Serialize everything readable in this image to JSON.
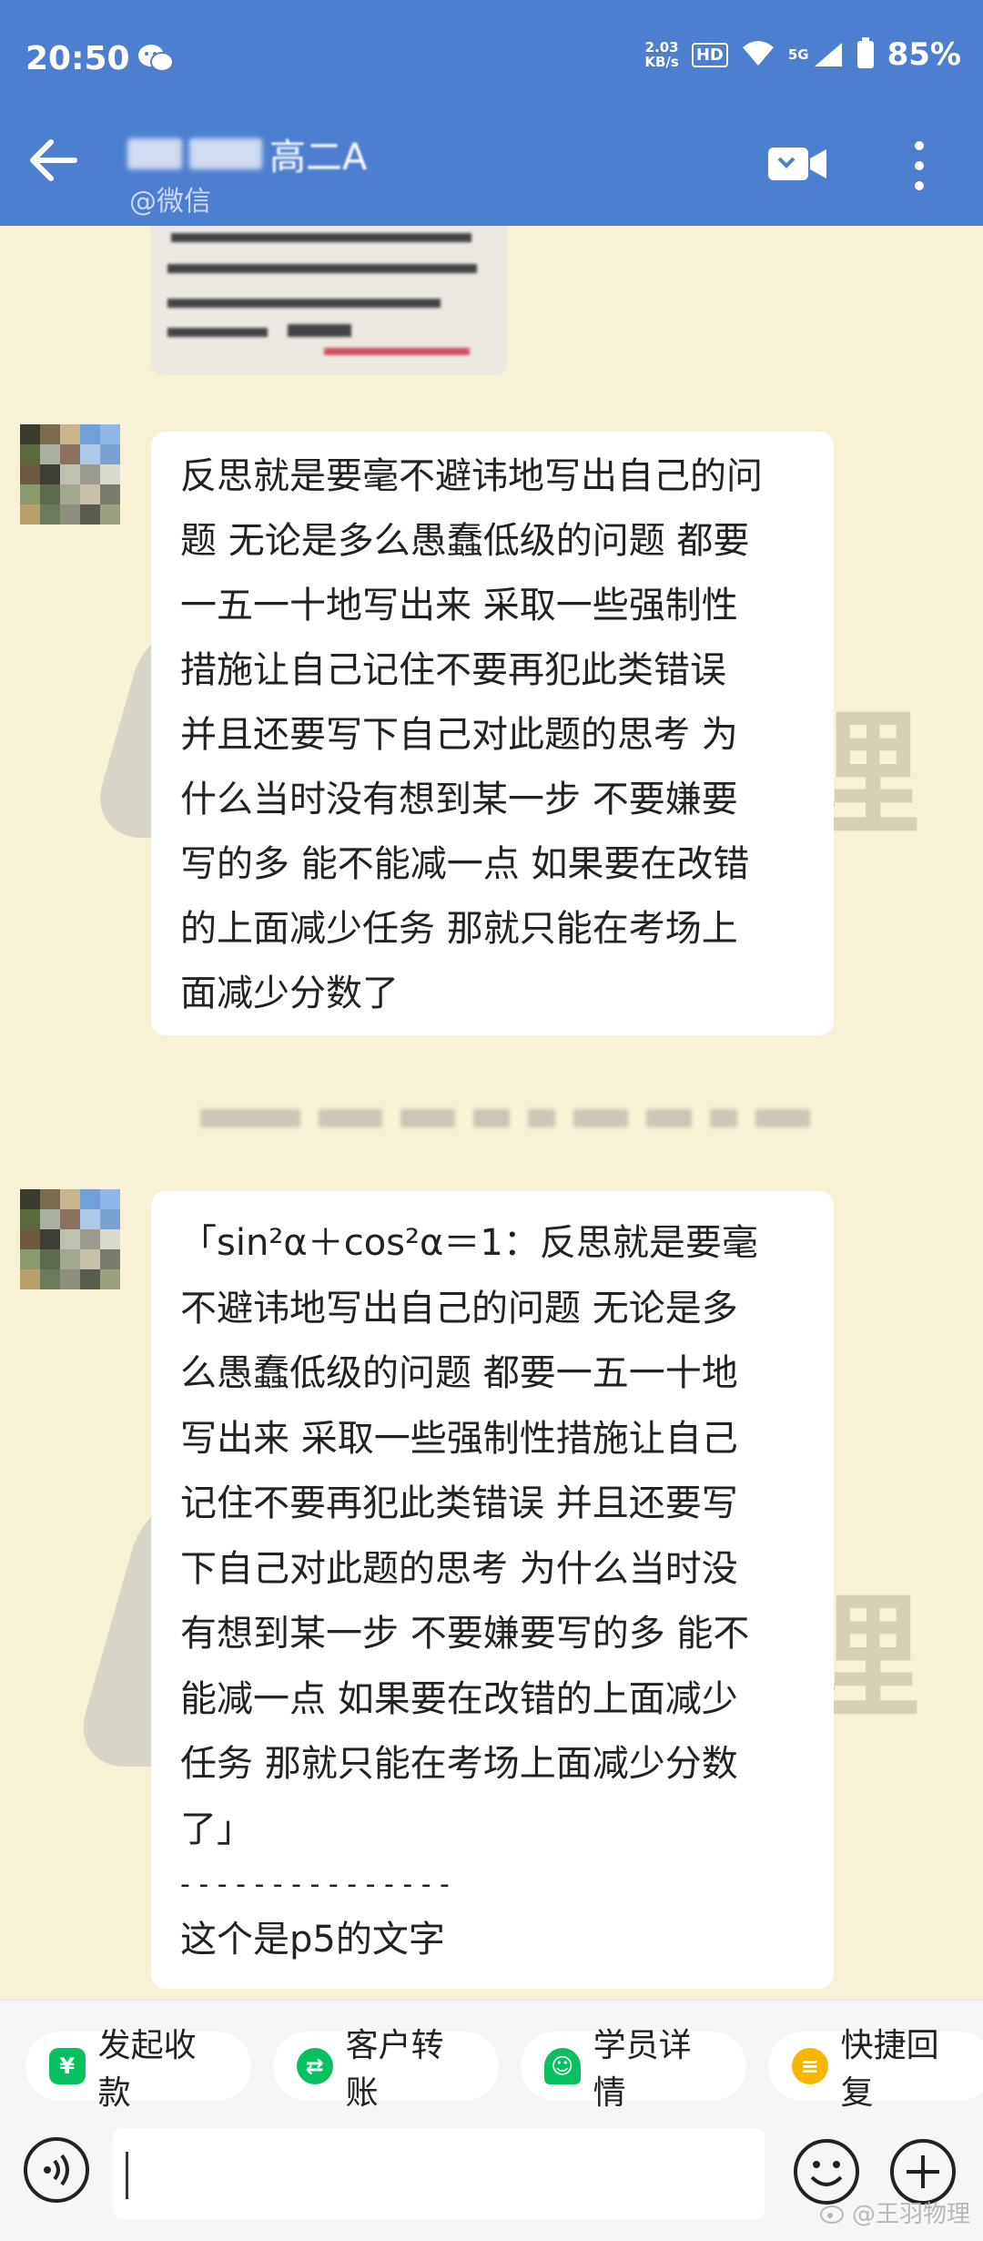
{
  "status_bar": {
    "time": "20:50",
    "net_speed_value": "2.03",
    "net_speed_unit": "KB/s",
    "hd_label": "HD",
    "signal_labels": "5G",
    "battery": "85%"
  },
  "header": {
    "title_visible": "高二A",
    "subtitle": "@微信"
  },
  "messages": [
    {
      "lines": [
        "反思就是要毫不避讳地写出自己的问",
        "题 无论是多么愚蠢低级的问题 都要",
        "一五一十地写出来 采取一些强制性",
        "措施让自己记住不要再犯此类错误",
        "并且还要写下自己对此题的思考 为",
        "什么当时没有想到某一步 不要嫌要",
        "写的多 能不能减一点 如果要在改错",
        "的上面减少任务 那就只能在考场上",
        "面减少分数了"
      ]
    },
    {
      "lines": [
        "「sin²α＋cos²α＝1：反思就是要毫",
        "不避讳地写出自己的问题 无论是多",
        "么愚蠢低级的问题 都要一五一十地",
        "写出来 采取一些强制性措施让自己",
        "记住不要再犯此类错误 并且还要写",
        "下自己对此题的思考 为什么当时没",
        "有想到某一步 不要嫌要写的多 能不",
        "能减一点 如果要在改错的上面减少",
        "任务 那就只能在考场上面减少分数",
        "了」",
        "- - - - - - - - - - - - - - -",
        "这个是p5的文字"
      ]
    }
  ],
  "watermark": {
    "char": "理"
  },
  "quick_actions": [
    {
      "label": "发起收款",
      "icon": "yen-icon",
      "color": "#07c160"
    },
    {
      "label": "客户转账",
      "icon": "transfer-icon",
      "color": "#07c160"
    },
    {
      "label": "学员详情",
      "icon": "student-icon",
      "color": "#07c160"
    },
    {
      "label": "快捷回复",
      "icon": "quick-reply-icon",
      "color": "#f7b500"
    }
  ],
  "input": {
    "placeholder": ""
  },
  "source_mark": "@王羽物理",
  "colors": {
    "header": "#4d7fd0",
    "chat_background": "#f7f1d6",
    "bubble": "#ffffff"
  }
}
